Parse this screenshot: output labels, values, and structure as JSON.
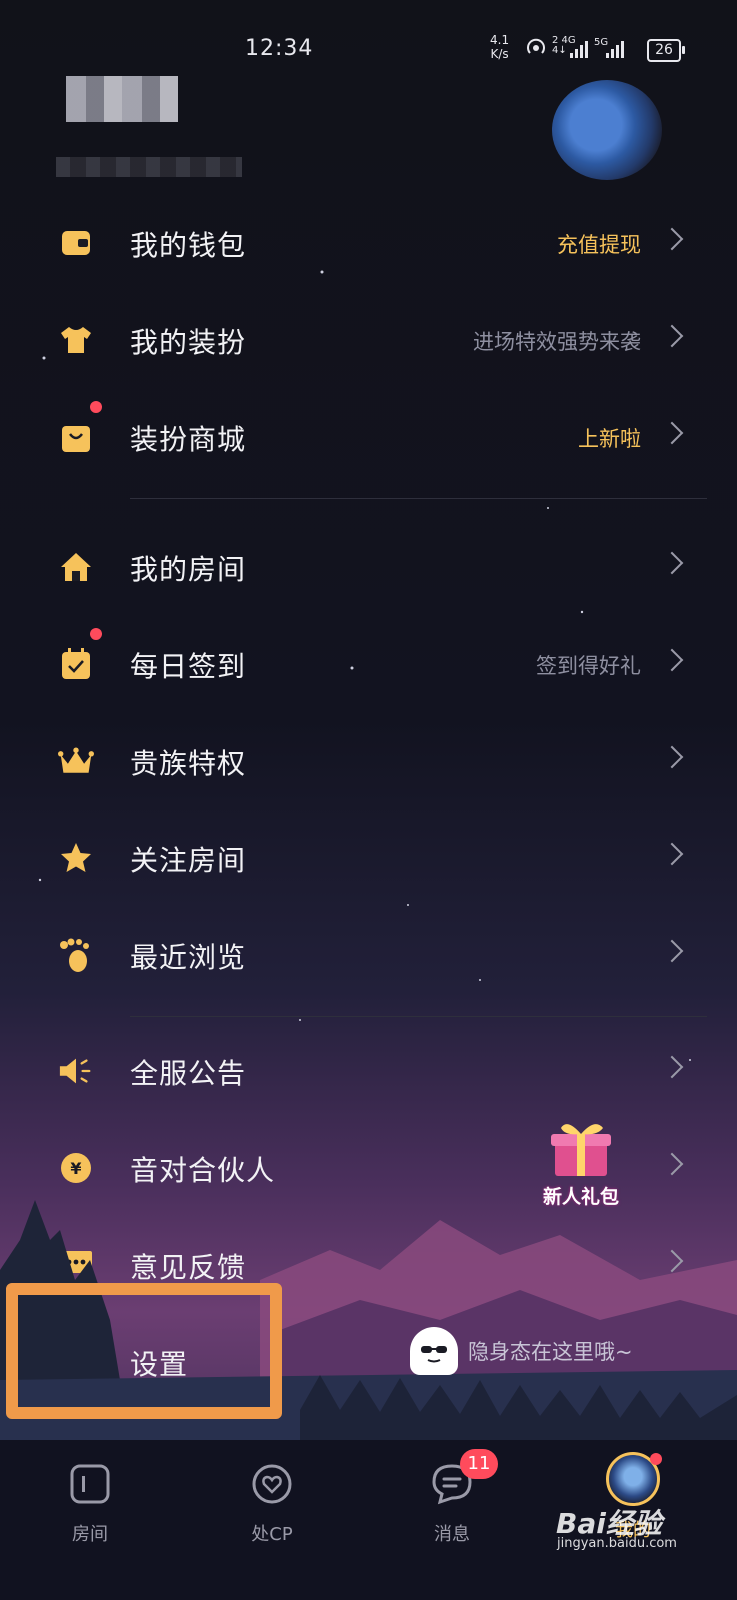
{
  "status_bar": {
    "time": "12:34",
    "net_speed": "4.1\nK/s",
    "sim1": "2 4G",
    "sim2": "5G",
    "battery": "26"
  },
  "menu": {
    "items": [
      {
        "label": "我的钱包",
        "hint": "充值提现",
        "icon": "wallet-icon"
      },
      {
        "label": "我的装扮",
        "hint": "进场特效强势来袭",
        "icon": "tshirt-icon"
      },
      {
        "label": "装扮商城",
        "hint": "上新啦",
        "icon": "shopping-bag-icon"
      },
      {
        "label": "我的房间",
        "hint": "",
        "icon": "home-icon"
      },
      {
        "label": "每日签到",
        "hint": "签到得好礼",
        "icon": "calendar-check-icon"
      },
      {
        "label": "贵族特权",
        "hint": "",
        "icon": "crown-icon"
      },
      {
        "label": "关注房间",
        "hint": "",
        "icon": "star-icon"
      },
      {
        "label": "最近浏览",
        "hint": "",
        "icon": "footprint-icon"
      },
      {
        "label": "全服公告",
        "hint": "",
        "icon": "speaker-icon"
      },
      {
        "label": "音对合伙人",
        "hint": "",
        "icon": "yen-coin-icon"
      },
      {
        "label": "意见反馈",
        "hint": "",
        "icon": "chat-dots-icon"
      },
      {
        "label": "设置",
        "hint": "隐身态在这里哦~",
        "icon": "gear-icon"
      }
    ]
  },
  "gift": {
    "label": "新人礼包"
  },
  "tabbar": {
    "tabs": [
      {
        "label": "房间",
        "icon": "room-icon"
      },
      {
        "label": "处CP",
        "icon": "heart-chat-icon"
      },
      {
        "label": "消息",
        "icon": "message-icon"
      },
      {
        "label": "我的",
        "icon": "avatar"
      }
    ],
    "message_badge": "11"
  },
  "watermark": {
    "text": "Bai经验",
    "url_text": "jingyan.baidu.com"
  },
  "colors": {
    "accent": "#f6c25b",
    "badge": "#ff4b5c",
    "highlight": "#f09a4a"
  }
}
